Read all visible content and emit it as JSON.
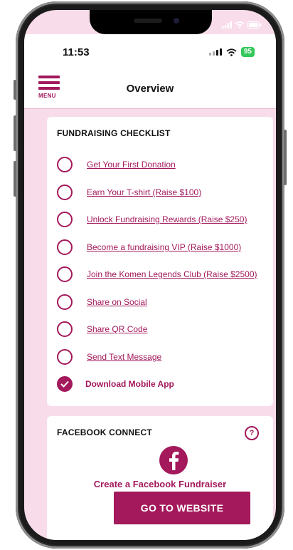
{
  "status": {
    "time": "11:53",
    "battery": "95"
  },
  "header": {
    "menu_label": "MENU",
    "title": "Overview"
  },
  "checklist": {
    "title": "FUNDRAISING CHECKLIST",
    "items": [
      {
        "label": "Get Your First Donation",
        "done": false
      },
      {
        "label": "Earn Your T-shirt (Raise $100)",
        "done": false
      },
      {
        "label": "Unlock Fundraising Rewards (Raise $250)",
        "done": false
      },
      {
        "label": "Become a fundraising VIP (Raise $1000)",
        "done": false
      },
      {
        "label": "Join the Komen Legends Club (Raise $2500)",
        "done": false
      },
      {
        "label": "Share on Social",
        "done": false
      },
      {
        "label": "Share QR Code",
        "done": false
      },
      {
        "label": "Send Text Message",
        "done": false
      },
      {
        "label": "Download Mobile App",
        "done": true
      }
    ]
  },
  "facebook": {
    "title": "FACEBOOK CONNECT",
    "help_icon": "?",
    "cta": "Create a Facebook Fundraiser",
    "button_label": "GO TO WEBSITE"
  },
  "colors": {
    "accent": "#a3195b",
    "background": "#f9dcea",
    "battery": "#34c759"
  }
}
